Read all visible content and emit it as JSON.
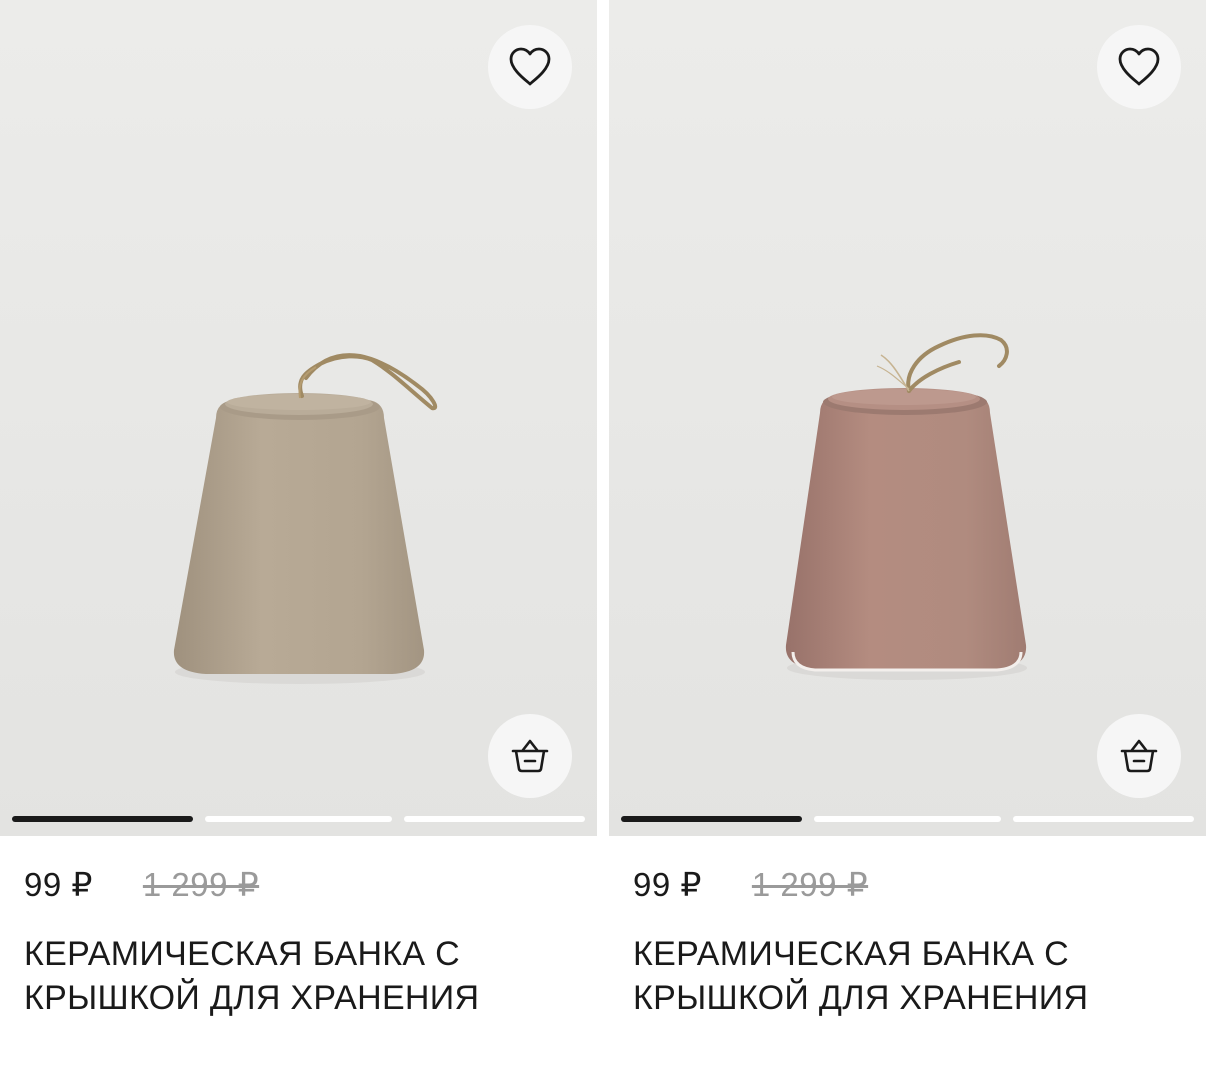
{
  "products": [
    {
      "price": "99 ₽",
      "old_price": "1 299 ₽",
      "title_line1": "КЕРАМИЧЕСКАЯ БАНКА С",
      "title_line2": "КРЫШКОЙ ДЛЯ ХРАНЕНИЯ",
      "jar_color": "#b5a793",
      "jar_shade": "#9d8f7c",
      "gallery_position": 1,
      "gallery_total": 3
    },
    {
      "price": "99 ₽",
      "old_price": "1 299 ₽",
      "title_line1": "КЕРАМИЧЕСКАЯ БАНКА С",
      "title_line2": "КРЫШКОЙ ДЛЯ ХРАНЕНИЯ",
      "jar_color": "#ad877b",
      "jar_shade": "#95706a",
      "gallery_position": 1,
      "gallery_total": 3
    }
  ],
  "icons": {
    "favorite": "heart-icon",
    "cart": "basket-icon"
  },
  "colors": {
    "photo_background": "#e7e7e5",
    "text": "#1a1a1a",
    "old_price": "#9a9a9a"
  }
}
